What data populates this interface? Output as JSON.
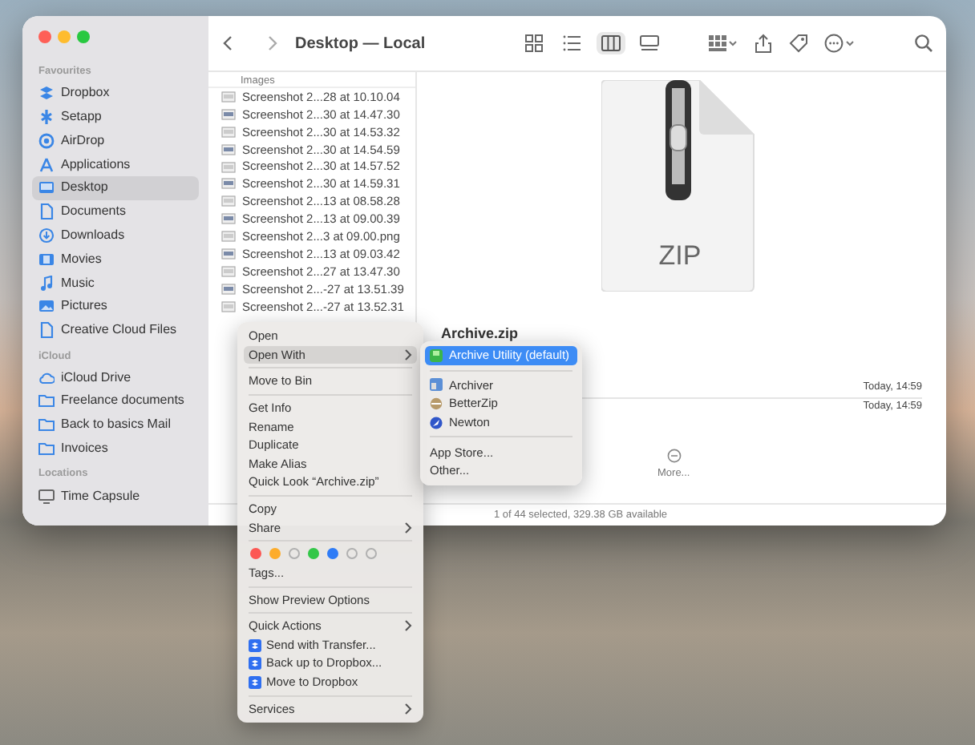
{
  "window": {
    "title": "Desktop — Local"
  },
  "toolbar": {
    "view_modes": [
      {
        "kind": "icons",
        "selected": false
      },
      {
        "kind": "list",
        "selected": false
      },
      {
        "kind": "columns",
        "selected": true
      },
      {
        "kind": "gallery",
        "selected": false
      }
    ]
  },
  "sidebar": {
    "sections": [
      {
        "heading": "Favourites",
        "items": [
          {
            "label": "Dropbox",
            "selected": false
          },
          {
            "label": "Setapp",
            "selected": false
          },
          {
            "label": "AirDrop",
            "selected": false
          },
          {
            "label": "Applications",
            "selected": false
          },
          {
            "label": "Desktop",
            "selected": true
          },
          {
            "label": "Documents",
            "selected": false
          },
          {
            "label": "Downloads",
            "selected": false
          },
          {
            "label": "Movies",
            "selected": false
          },
          {
            "label": "Music",
            "selected": false
          },
          {
            "label": "Pictures",
            "selected": false
          },
          {
            "label": "Creative Cloud Files",
            "selected": false
          }
        ]
      },
      {
        "heading": "iCloud",
        "items": [
          {
            "label": "iCloud Drive",
            "selected": false
          },
          {
            "label": "Freelance documents",
            "selected": false
          },
          {
            "label": "Back to basics Mail",
            "selected": false
          },
          {
            "label": "Invoices",
            "selected": false
          }
        ]
      },
      {
        "heading": "Locations",
        "items": [
          {
            "label": "Time Capsule",
            "selected": false
          }
        ]
      }
    ]
  },
  "column": {
    "heading": "Images",
    "files": [
      "Screenshot 2...28 at 10.10.04",
      "Screenshot 2...30 at 14.47.30",
      "Screenshot 2...30 at 14.53.32",
      "Screenshot 2...30 at 14.54.59",
      "Screenshot 2...30 at 14.57.52",
      "Screenshot 2...30 at 14.59.31",
      "Screenshot 2...13 at 08.58.28",
      "Screenshot 2...13 at 09.00.39",
      "Screenshot 2...3 at 09.00.png",
      "Screenshot 2...13 at 09.03.42",
      "Screenshot 2...27 at 13.47.30",
      "Screenshot 2...-27 at 13.51.39",
      "Screenshot 2...-27 at 13.52.31"
    ]
  },
  "preview": {
    "icon_label": "ZIP",
    "filename": "Archive.zip",
    "dates": [
      "Today, 14:59",
      "Today, 14:59"
    ],
    "more": "More..."
  },
  "status_bar": "1 of 44 selected, 329.38 GB available",
  "context_menu": [
    {
      "kind": "item",
      "label": "Open",
      "submenu": false,
      "highlighted": false
    },
    {
      "kind": "item",
      "label": "Open With",
      "submenu": true,
      "highlighted": true
    },
    {
      "kind": "separator"
    },
    {
      "kind": "item",
      "label": "Move to Bin",
      "submenu": false,
      "highlighted": false
    },
    {
      "kind": "separator"
    },
    {
      "kind": "item",
      "label": "Get Info",
      "submenu": false,
      "highlighted": false
    },
    {
      "kind": "item",
      "label": "Rename",
      "submenu": false,
      "highlighted": false
    },
    {
      "kind": "item",
      "label": "Duplicate",
      "submenu": false,
      "highlighted": false
    },
    {
      "kind": "item",
      "label": "Make Alias",
      "submenu": false,
      "highlighted": false
    },
    {
      "kind": "item",
      "label": "Quick Look “Archive.zip”",
      "submenu": false,
      "highlighted": false
    },
    {
      "kind": "separator"
    },
    {
      "kind": "item",
      "label": "Copy",
      "submenu": false,
      "highlighted": false
    },
    {
      "kind": "item",
      "label": "Share",
      "submenu": true,
      "highlighted": false
    },
    {
      "kind": "separator"
    },
    {
      "kind": "tags",
      "tags": [
        {
          "color": "#fc5753",
          "filled": true
        },
        {
          "color": "#fdac2a",
          "filled": true
        },
        {
          "color": "#b0b0b0",
          "filled": false
        },
        {
          "color": "#33c748",
          "filled": true
        },
        {
          "color": "#2f7cf6",
          "filled": true
        },
        {
          "color": "#b0b0b0",
          "filled": false
        },
        {
          "color": "#b0b0b0",
          "filled": false
        }
      ]
    },
    {
      "kind": "item",
      "label": "Tags...",
      "submenu": false,
      "highlighted": false
    },
    {
      "kind": "separator"
    },
    {
      "kind": "item",
      "label": "Show Preview Options",
      "submenu": false,
      "highlighted": false
    },
    {
      "kind": "separator"
    },
    {
      "kind": "item",
      "label": "Quick Actions",
      "submenu": true,
      "highlighted": false
    },
    {
      "kind": "action",
      "label": "Send with Transfer...",
      "submenu": false,
      "highlighted": false
    },
    {
      "kind": "action",
      "label": "Back up to Dropbox...",
      "submenu": false,
      "highlighted": false
    },
    {
      "kind": "action",
      "label": "Move to Dropbox",
      "submenu": false,
      "highlighted": false
    },
    {
      "kind": "separator"
    },
    {
      "kind": "item",
      "label": "Services",
      "submenu": true,
      "highlighted": false
    }
  ],
  "open_with_menu": [
    {
      "kind": "app",
      "label": "Archive Utility (default)",
      "selected": true
    },
    {
      "kind": "separator"
    },
    {
      "kind": "app",
      "label": "Archiver",
      "selected": false
    },
    {
      "kind": "app",
      "label": "BetterZip",
      "selected": false
    },
    {
      "kind": "app",
      "label": "Newton",
      "selected": false
    },
    {
      "kind": "separator"
    },
    {
      "kind": "item",
      "label": "App Store...",
      "selected": false
    },
    {
      "kind": "item",
      "label": "Other...",
      "selected": false
    }
  ]
}
